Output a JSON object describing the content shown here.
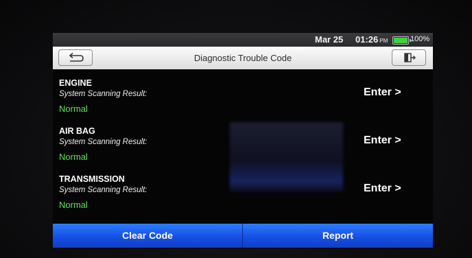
{
  "status_bar": {
    "date": "Mar 25",
    "time": "01:26",
    "ampm": "PM",
    "battery_percent": "100%",
    "battery_level": 1.0
  },
  "header": {
    "title": "Diagnostic Trouble Code",
    "back_icon": "return-arrow-icon",
    "exit_icon": "exit-door-icon"
  },
  "systems": [
    {
      "name": "ENGINE",
      "label": "System Scanning Result:",
      "result": "Normal",
      "action": "Enter >"
    },
    {
      "name": "AIR BAG",
      "label": "System Scanning Result:",
      "result": "Normal",
      "action": "Enter >"
    },
    {
      "name": "TRANSMISSION",
      "label": "System Scanning Result:",
      "result": "Normal",
      "action": "Enter >"
    }
  ],
  "footer": {
    "clear_label": "Clear Code",
    "report_label": "Report"
  },
  "colors": {
    "result_ok": "#55e655",
    "footer_blue": "#1f5ef0",
    "battery_green": "#3fd23f"
  }
}
